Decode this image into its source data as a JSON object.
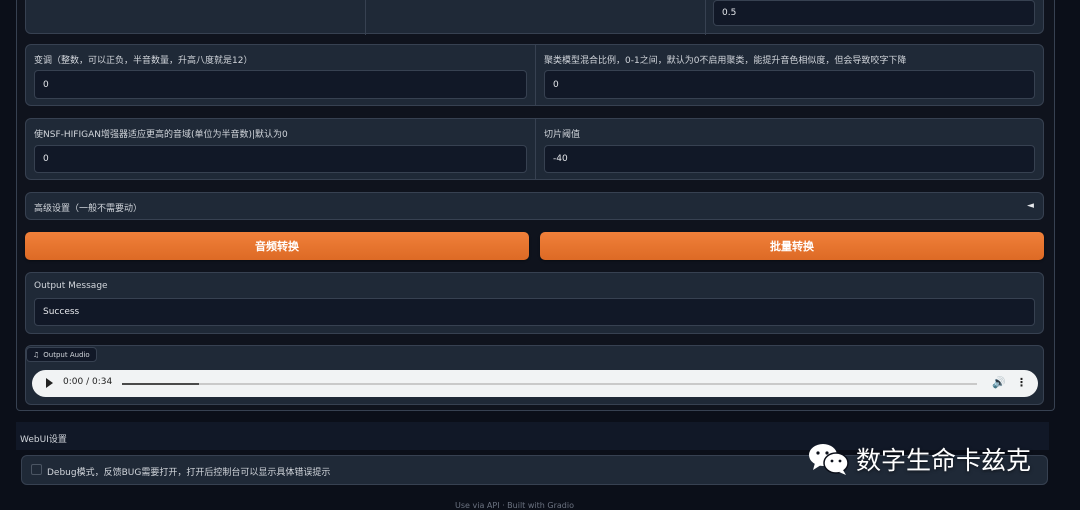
{
  "top_row": {
    "field3_value": "0.5"
  },
  "row_transpose": {
    "transpose_label": "变调（整数，可以正负，半音数量，升高八度就是12）",
    "transpose_value": "0",
    "cluster_label": "聚类模型混合比例，0-1之间，默认为0不启用聚类，能提升音色相似度，但会导致咬字下降",
    "cluster_value": "0"
  },
  "row_nsf": {
    "nsf_label": "使NSF-HIFIGAN增强器适应更高的音域(单位为半音数)|默认为0",
    "nsf_value": "0",
    "slice_label": "切片阈值",
    "slice_value": "-40"
  },
  "advanced": {
    "label": "高级设置（一般不需要动）",
    "arrow": "◄"
  },
  "buttons": {
    "convert": "音频转换",
    "batch": "批量转换"
  },
  "output_message": {
    "label": "Output Message",
    "value": "Success"
  },
  "output_audio": {
    "label": "Output Audio",
    "icon": "music-note-icon",
    "time": "0:00 / 0:34",
    "played_fraction": 0.09
  },
  "webui": {
    "title": "WebUI设置",
    "debug_label": "Debug模式，反馈BUG需要打开，打开后控制台可以显示具体错误提示"
  },
  "watermark": {
    "text": "数字生命卡兹克",
    "icon": "wechat-icon"
  },
  "footer": {
    "text": "Use via API · Built with Gradio"
  },
  "colors": {
    "accent": "#e8742f",
    "background": "#0b0f19",
    "panel": "#1f2937"
  }
}
